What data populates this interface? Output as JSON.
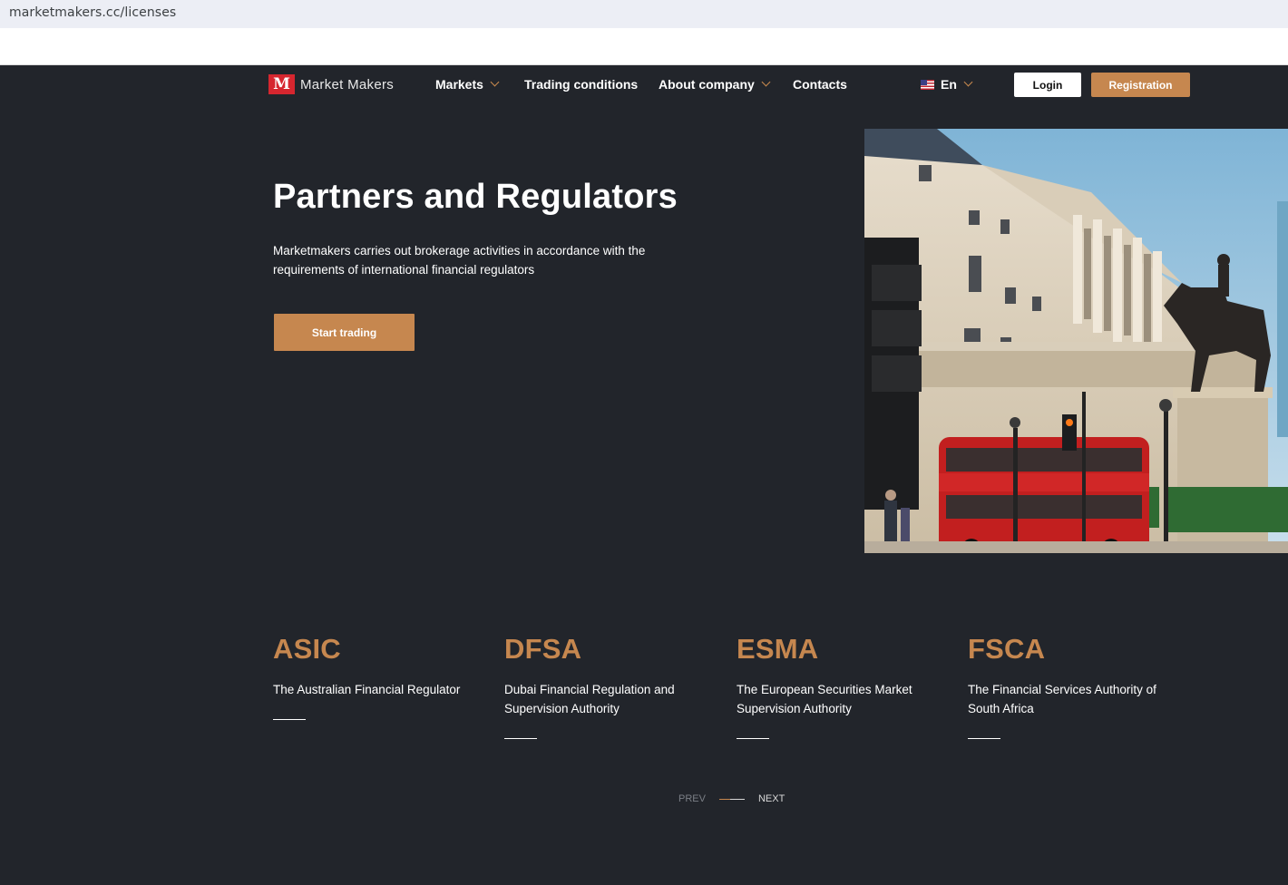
{
  "browser": {
    "url": "marketmakers.cc/licenses"
  },
  "header": {
    "logo_mark": "M",
    "logo_text": "Market Makers",
    "nav": [
      {
        "label": "Markets",
        "dropdown": true
      },
      {
        "label": "Trading conditions",
        "dropdown": false
      },
      {
        "label": "About company",
        "dropdown": true
      },
      {
        "label": "Contacts",
        "dropdown": false
      }
    ],
    "language": "En",
    "login_label": "Login",
    "registration_label": "Registration"
  },
  "hero": {
    "title": "Partners and Regulators",
    "description": "Marketmakers carries out brokerage activities in accordance with the requirements of international financial regulators",
    "cta_label": "Start trading"
  },
  "regulators": [
    {
      "code": "ASIC",
      "name": "The Australian Financial Regulator"
    },
    {
      "code": "DFSA",
      "name": "Dubai Financial Regulation and Supervision Authority"
    },
    {
      "code": "ESMA",
      "name": "The European Securities Market Supervision Authority"
    },
    {
      "code": "FSCA",
      "name": "The Financial Services Authority of South Africa"
    }
  ],
  "pager": {
    "prev_label": "PREV",
    "next_label": "NEXT"
  },
  "colors": {
    "background": "#22252b",
    "accent": "#c6874f",
    "logo_red": "#d6262f"
  }
}
